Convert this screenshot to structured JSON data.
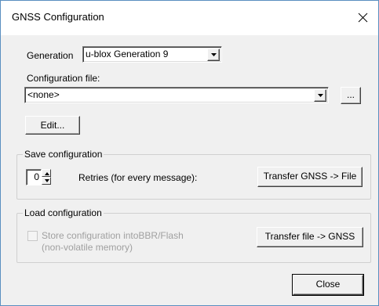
{
  "window": {
    "title": "GNSS Configuration",
    "close_icon": "close-icon"
  },
  "generation": {
    "label": "Generation",
    "value": "u-blox Generation 9"
  },
  "config_file": {
    "label": "Configuration file:",
    "value": "<none>",
    "browse_label": "..."
  },
  "edit_button": "Edit...",
  "save_group": {
    "title": "Save configuration",
    "retries_value": "0",
    "retries_label": "Retries (for every message):",
    "transfer_label": "Transfer GNSS -> File"
  },
  "load_group": {
    "title": "Load configuration",
    "store_label_line1": "Store configuration intoBBR/Flash",
    "store_label_line2": "(non-volatile memory)",
    "store_checked": false,
    "transfer_label": "Transfer file -> GNSS"
  },
  "close_button": "Close",
  "colors": {
    "dialog_bg": "#f0f0f0",
    "title_bg": "#ffffff",
    "border_accent": "#5a8fc0",
    "disabled_text": "#a0a0a0"
  }
}
